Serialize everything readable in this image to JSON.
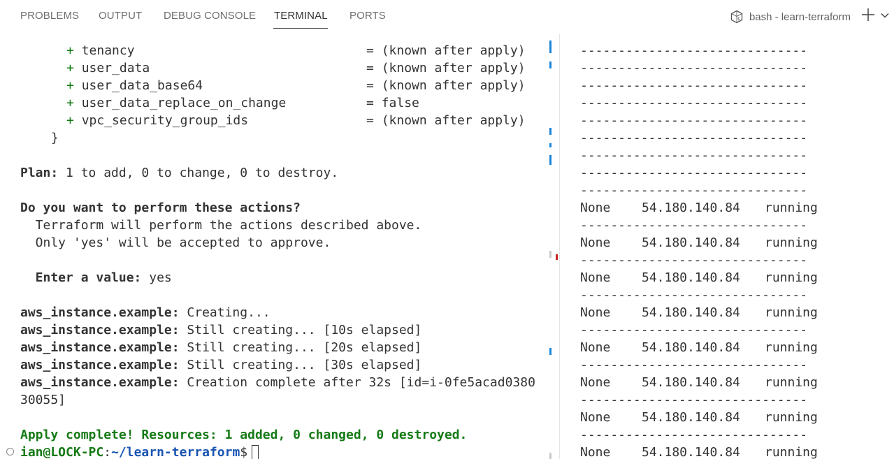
{
  "tabs": [
    {
      "label": "PROBLEMS",
      "active": false
    },
    {
      "label": "OUTPUT",
      "active": false
    },
    {
      "label": "DEBUG CONSOLE",
      "active": false
    },
    {
      "label": "TERMINAL",
      "active": true
    },
    {
      "label": "PORTS",
      "active": false
    }
  ],
  "terminal_title": "bash - learn-terraform",
  "icons": {
    "shell": "terminal-shell-icon",
    "new_terminal": "plus-icon",
    "dropdown": "chevron-down-icon",
    "decoration": "circle-icon"
  },
  "colors": {
    "plus_green": "#0f7a0f",
    "success_green": "#167a16",
    "path_blue": "#1a55b3",
    "mark_blue": "#1a85d6",
    "mark_red": "#cc2222"
  },
  "left": {
    "attrs": [
      {
        "plus": "+",
        "name": "tenancy",
        "eq": "=",
        "value": "(known after apply)"
      },
      {
        "plus": "+",
        "name": "user_data",
        "eq": "=",
        "value": "(known after apply)"
      },
      {
        "plus": "+",
        "name": "user_data_base64",
        "eq": "=",
        "value": "(known after apply)"
      },
      {
        "plus": "+",
        "name": "user_data_replace_on_change",
        "eq": "=",
        "value": "false"
      },
      {
        "plus": "+",
        "name": "vpc_security_group_ids",
        "eq": "=",
        "value": "(known after apply)"
      }
    ],
    "close_brace": "}",
    "plan_label": "Plan:",
    "plan_text": " 1 to add, 0 to change, 0 to destroy.",
    "question": "Do you want to perform these actions?",
    "desc1": "  Terraform will perform the actions described above.",
    "desc2": "  Only 'yes' will be accepted to approve.",
    "enter_label": "  Enter a value:",
    "enter_value": " yes",
    "log": [
      {
        "res": "aws_instance.example:",
        "msg": " Creating..."
      },
      {
        "res": "aws_instance.example:",
        "msg": " Still creating... [10s elapsed]"
      },
      {
        "res": "aws_instance.example:",
        "msg": " Still creating... [20s elapsed]"
      },
      {
        "res": "aws_instance.example:",
        "msg": " Still creating... [30s elapsed]"
      },
      {
        "res": "aws_instance.example:",
        "msg": " Creation complete after 32s [id=i-0fe5acad0380"
      }
    ],
    "log_wrap": "30055]",
    "apply_complete": "Apply complete! Resources: 1 added, 0 changed, 0 destroyed.",
    "prompt_user": "ian@LOCK-PC",
    "prompt_colon": ":",
    "prompt_path": "~/learn-terraform",
    "prompt_dollar": "$"
  },
  "right": {
    "separator": "------------------------------",
    "rows": [
      {
        "name": "None",
        "ip": "54.180.140.84",
        "state": "running"
      },
      {
        "name": "None",
        "ip": "54.180.140.84",
        "state": "running"
      },
      {
        "name": "None",
        "ip": "54.180.140.84",
        "state": "running"
      },
      {
        "name": "None",
        "ip": "54.180.140.84",
        "state": "running"
      },
      {
        "name": "None",
        "ip": "54.180.140.84",
        "state": "running"
      },
      {
        "name": "None",
        "ip": "54.180.140.84",
        "state": "running"
      },
      {
        "name": "None",
        "ip": "54.180.140.84",
        "state": "running"
      },
      {
        "name": "None",
        "ip": "54.180.140.84",
        "state": "running"
      }
    ]
  }
}
